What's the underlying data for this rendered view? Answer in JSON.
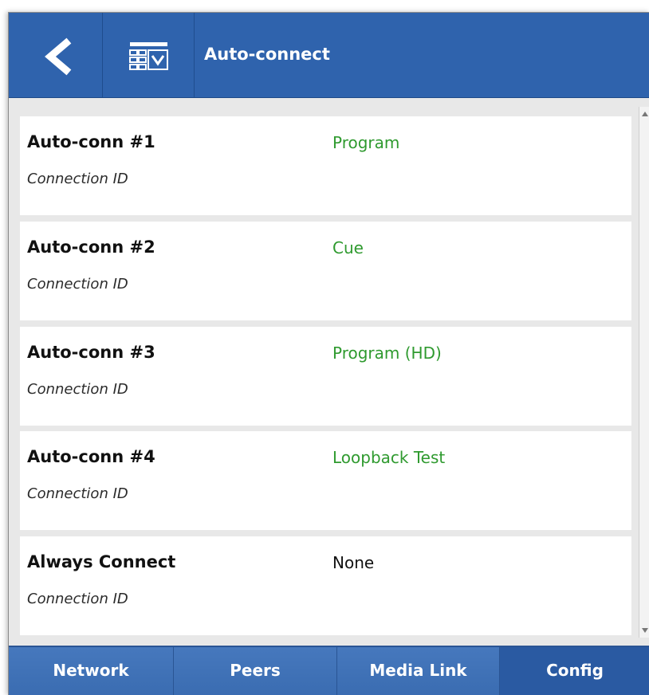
{
  "header": {
    "title": "Auto-connect",
    "back_icon": "chevron-left-icon",
    "menu_icon": "grid-download-icon"
  },
  "rows": [
    {
      "label": "Auto-conn #1",
      "sublabel": "Connection ID",
      "value": "Program",
      "value_color": "#2f9a2f"
    },
    {
      "label": "Auto-conn #2",
      "sublabel": "Connection ID",
      "value": "Cue",
      "value_color": "#2f9a2f"
    },
    {
      "label": "Auto-conn #3",
      "sublabel": "Connection ID",
      "value": "Program (HD)",
      "value_color": "#2f9a2f"
    },
    {
      "label": "Auto-conn #4",
      "sublabel": "Connection ID",
      "value": "Loopback Test",
      "value_color": "#2f9a2f"
    },
    {
      "label": "Always Connect",
      "sublabel": "Connection ID",
      "value": "None",
      "value_color": "#111111"
    }
  ],
  "tabs": [
    {
      "label": "Network",
      "active": false
    },
    {
      "label": "Peers",
      "active": false
    },
    {
      "label": "Media Link",
      "active": false
    },
    {
      "label": "Config",
      "active": true
    }
  ],
  "colors": {
    "header_bg": "#2f63ad",
    "tab_active_bg": "#2a5aa2",
    "accent_green": "#2f9a2f"
  }
}
